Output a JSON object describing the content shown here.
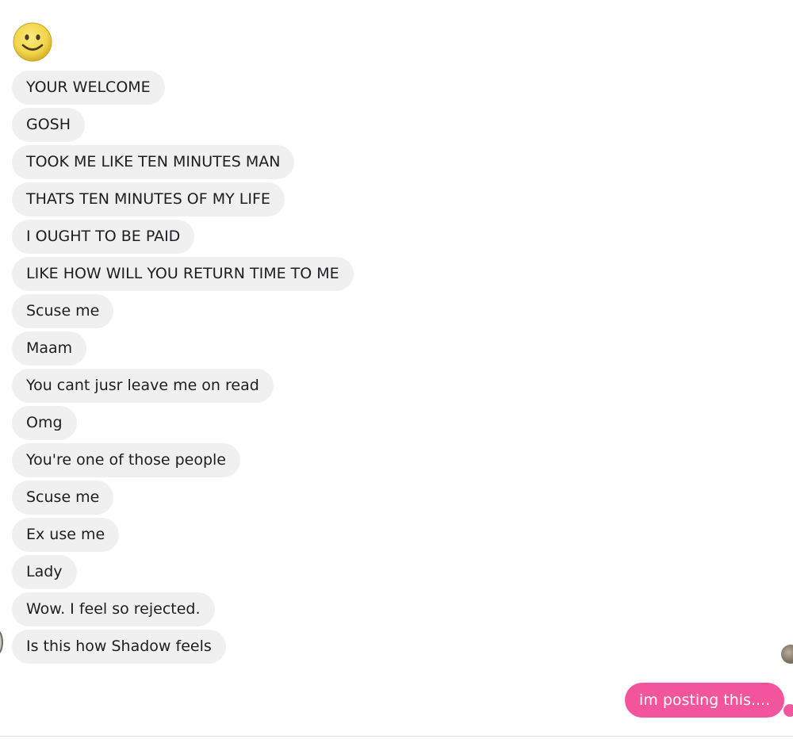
{
  "conversation": {
    "incoming_messages": [
      "YOUR WELCOME",
      "GOSH",
      "TOOK ME LIKE TEN MINUTES MAN",
      "THATS TEN MINUTES OF MY LIFE",
      "I OUGHT TO BE PAID",
      "LIKE HOW WILL YOU RETURN TIME TO ME",
      "Scuse me",
      "Maam",
      "You cant jusr leave me on read",
      "Omg",
      "You're one of those people",
      "Scuse me",
      "Ex use me",
      "Lady",
      "Wow. I feel so rejected.",
      "Is this how Shadow feels"
    ],
    "outgoing_message": "im posting this....",
    "emoji": "slightly-smiling-face-icon"
  },
  "colors": {
    "incoming_bubble": "#f1f0f0",
    "outgoing_bubble": "#f2559c",
    "incoming_text": "#1c1e21",
    "outgoing_text": "#ffffff",
    "emoji_face": "#f6d84c"
  }
}
